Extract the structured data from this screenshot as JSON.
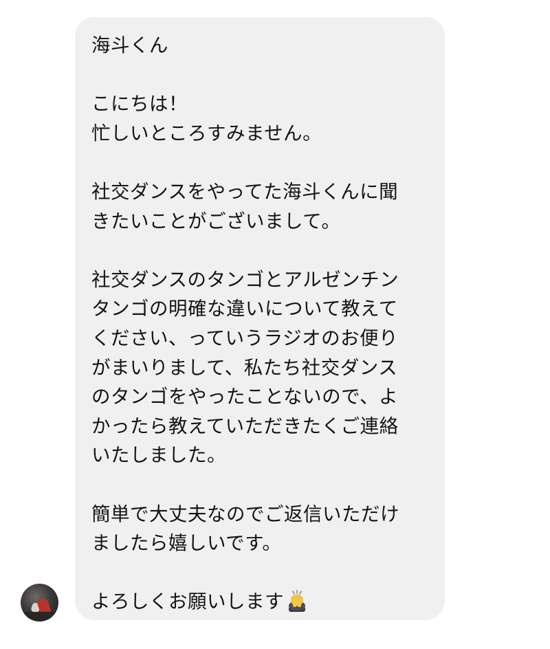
{
  "message": {
    "greeting": "海斗くん",
    "lines": [
      "海斗くん",
      "",
      "こにちは！",
      "忙しいところすみません。",
      "",
      "社交ダンスをやってた海斗くんに聞",
      "きたいことがございまして。",
      "",
      "社交ダンスのタンゴとアルゼンチン",
      "タンゴの明確な違いについて教えて",
      "ください、っていうラジオのお便り",
      "がまいりまして、私たち社交ダンス",
      "のタンゴをやったことないので、よ",
      "かったら教えていただきたくご連絡",
      "いたしました。",
      "",
      "簡単で大丈夫なのでご返信いただけ",
      "ましたら嬉しいです。",
      "",
      "よろしくお願いします"
    ],
    "closing_emoji": "bowing-person-emoji"
  },
  "sender": {
    "avatar": "profile-photo-dancer"
  },
  "colors": {
    "bubble_bg": "#f0f0f0",
    "text": "#141414",
    "page_bg": "#ffffff"
  }
}
